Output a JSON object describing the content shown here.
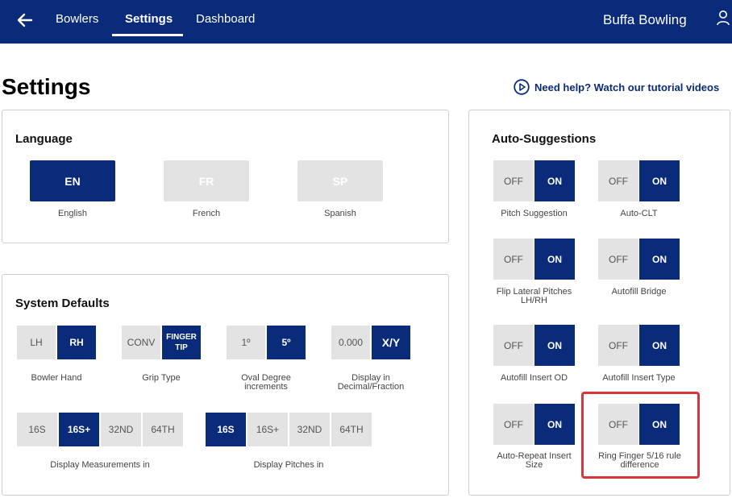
{
  "topbar": {
    "nav": [
      "Bowlers",
      "Settings",
      "Dashboard"
    ],
    "brand": "Buffa Bowling"
  },
  "page": {
    "title": "Settings",
    "help_link": "Need help? Watch our tutorial videos"
  },
  "language": {
    "title": "Language",
    "options": [
      {
        "code": "EN",
        "label": "English"
      },
      {
        "code": "FR",
        "label": "French"
      },
      {
        "code": "SP",
        "label": "Spanish"
      }
    ]
  },
  "system_defaults": {
    "title": "System Defaults",
    "bowler_hand": {
      "options": [
        "LH",
        "RH"
      ],
      "label": "Bowler Hand"
    },
    "grip_type": {
      "options": [
        "CONV",
        "FINGER TIP"
      ],
      "label": "Grip Type"
    },
    "oval_degree": {
      "options": [
        "1º",
        "5º"
      ],
      "label": "Oval Degree increments"
    },
    "display": {
      "options": [
        "0.000",
        "X/Y"
      ],
      "label": "Display in Decimal/Fraction"
    },
    "measurements": {
      "options": [
        "16S",
        "16S+",
        "32ND",
        "64TH"
      ],
      "label": "Display Measurements in"
    },
    "pitches": {
      "options": [
        "16S",
        "16S+",
        "32ND",
        "64TH"
      ],
      "label": "Display Pitches in"
    }
  },
  "auto_suggestions": {
    "title": "Auto-Suggestions",
    "off_label": "OFF",
    "on_label": "ON",
    "items": [
      "Pitch Suggestion",
      "Auto-CLT",
      "Flip Lateral Pitches LH/RH",
      "Autofill Bridge",
      "Autofill Insert OD",
      "Autofill Insert Type",
      "Auto-Repeat Insert Size",
      "Ring Finger 5/16 rule difference"
    ]
  },
  "colors": {
    "primary": "#0a2a7a",
    "inactive": "#e3e3e3",
    "highlight": "#d9363a"
  }
}
